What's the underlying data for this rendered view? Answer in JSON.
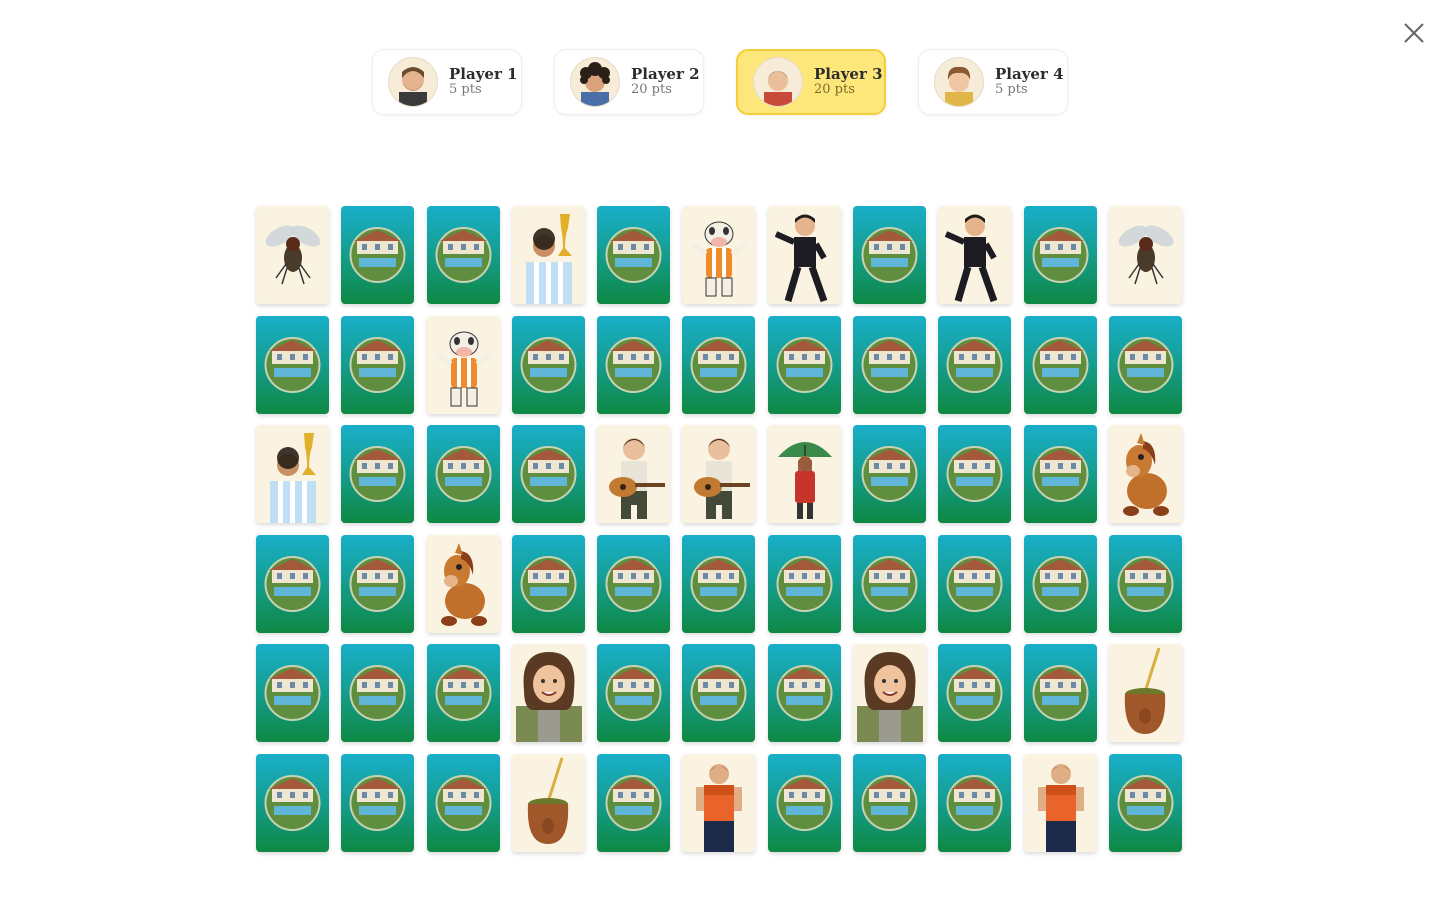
{
  "game": {
    "close_icon": "close-icon",
    "players": [
      {
        "name": "Player 1",
        "points": "5 pts",
        "active": false,
        "avatar": "bearded-man-avatar"
      },
      {
        "name": "Player 2",
        "points": "20 pts",
        "active": false,
        "avatar": "curly-hair-boy-avatar"
      },
      {
        "name": "Player 3",
        "points": "20 pts",
        "active": true,
        "avatar": "short-hair-boy-avatar"
      },
      {
        "name": "Player 4",
        "points": "5 pts",
        "active": false,
        "avatar": "brown-hair-boy-avatar"
      }
    ],
    "colors": {
      "active_player_bg": "#fde77a",
      "active_player_border": "#f2cf3a",
      "card_back_top": "#19afc9",
      "card_back_bottom": "#0e8843",
      "card_face_bg": "#fbf3e1"
    },
    "board": {
      "columns": 11,
      "rows": 6,
      "card_back_image": "house-with-pool",
      "cards": [
        "fly",
        "back",
        "back",
        "world-cup-player",
        "back",
        "cow-mascot",
        "black-suit-man",
        "back",
        "black-suit-man",
        "back",
        "fly",
        "back",
        "back",
        "cow-mascot",
        "back",
        "back",
        "back",
        "back",
        "back",
        "back",
        "back",
        "back",
        "world-cup-player",
        "back",
        "back",
        "back",
        "guitar-boy",
        "guitar-boy",
        "umbrella-woman",
        "back",
        "back",
        "back",
        "plush-horse",
        "back",
        "back",
        "plush-horse",
        "back",
        "back",
        "back",
        "back",
        "back",
        "back",
        "back",
        "back",
        "back",
        "back",
        "back",
        "smiling-woman",
        "back",
        "back",
        "back",
        "smiling-woman",
        "back",
        "back",
        "mate-gourd",
        "back",
        "back",
        "back",
        "mate-gourd",
        "back",
        "basketball-player",
        "back",
        "back",
        "back",
        "basketball-player",
        "back"
      ]
    }
  }
}
